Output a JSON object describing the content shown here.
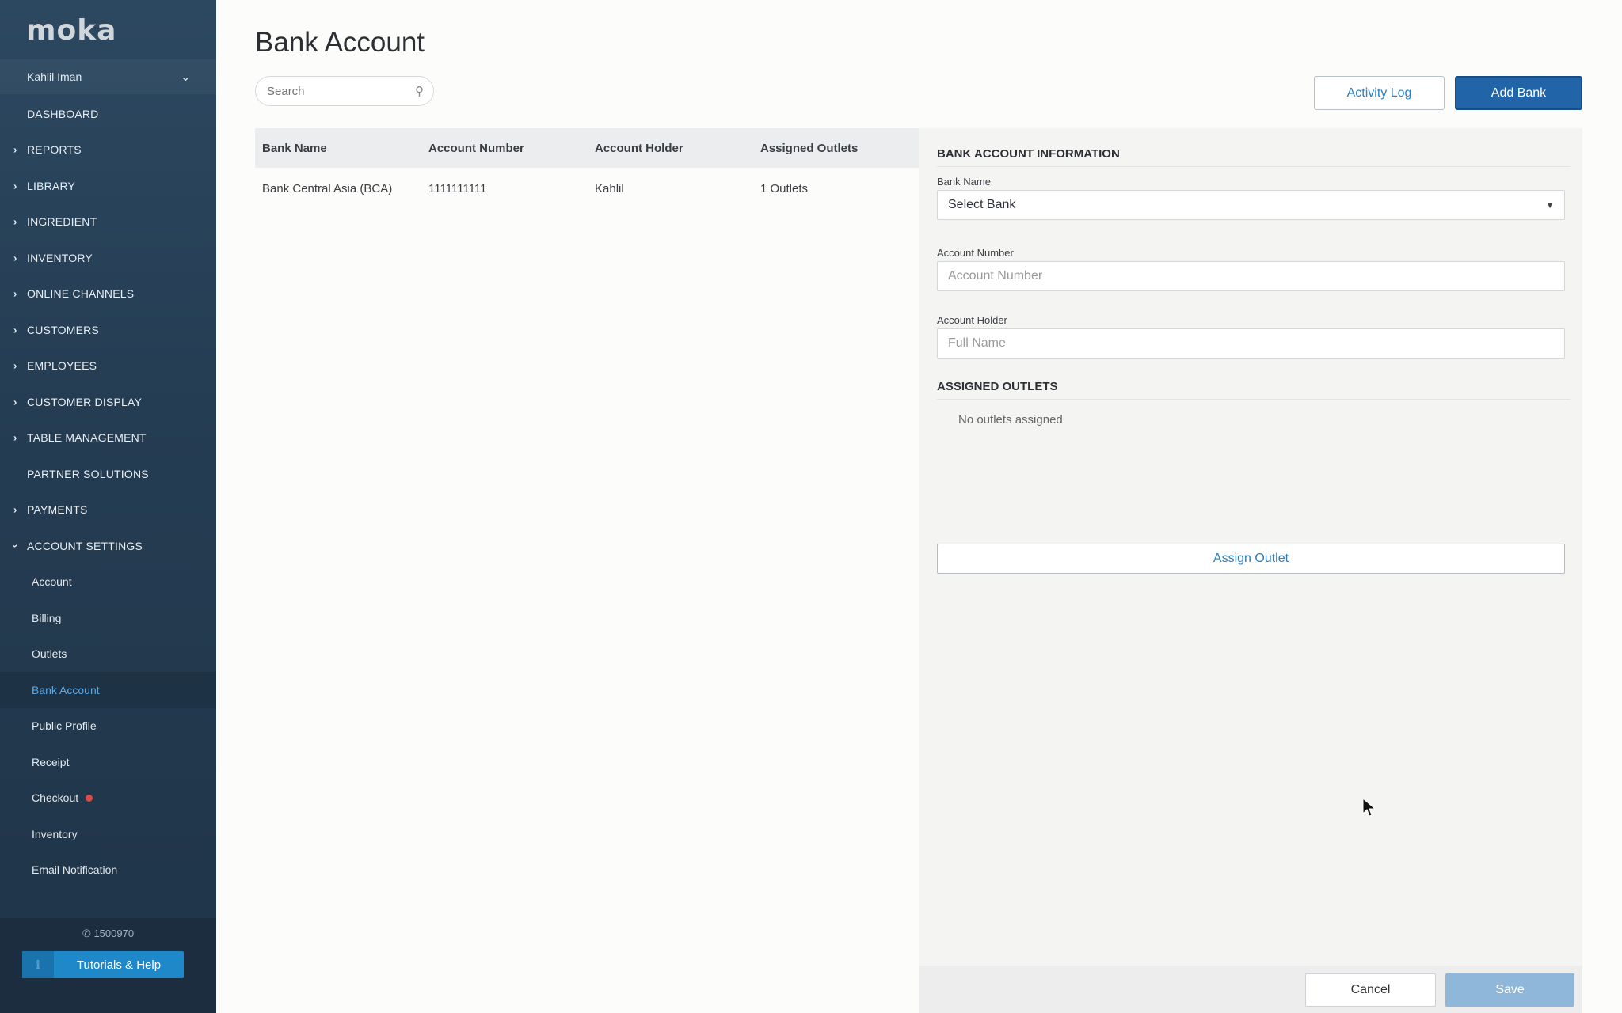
{
  "app": {
    "logo": "moka"
  },
  "sidebar": {
    "user": "Kahlil Iman",
    "nav": [
      {
        "label": "DASHBOARD",
        "arrow": false
      },
      {
        "label": "REPORTS",
        "arrow": true
      },
      {
        "label": "LIBRARY",
        "arrow": true
      },
      {
        "label": "INGREDIENT",
        "arrow": true
      },
      {
        "label": "INVENTORY",
        "arrow": true
      },
      {
        "label": "ONLINE CHANNELS",
        "arrow": true
      },
      {
        "label": "CUSTOMERS",
        "arrow": true
      },
      {
        "label": "EMPLOYEES",
        "arrow": true
      },
      {
        "label": "CUSTOMER DISPLAY",
        "arrow": true
      },
      {
        "label": "TABLE MANAGEMENT",
        "arrow": true
      },
      {
        "label": "PARTNER SOLUTIONS",
        "arrow": false
      },
      {
        "label": "PAYMENTS",
        "arrow": true
      },
      {
        "label": "ACCOUNT SETTINGS",
        "arrow": true,
        "expanded": true
      }
    ],
    "sub_items": [
      {
        "label": "Account"
      },
      {
        "label": "Billing"
      },
      {
        "label": "Outlets"
      },
      {
        "label": "Bank Account",
        "active": true
      },
      {
        "label": "Public Profile"
      },
      {
        "label": "Receipt"
      },
      {
        "label": "Checkout",
        "dot": true
      },
      {
        "label": "Inventory"
      },
      {
        "label": "Email Notification"
      }
    ],
    "phone": "1500970",
    "help_button": "Tutorials & Help"
  },
  "main": {
    "title": "Bank Account",
    "search_placeholder": "Search",
    "activity_log": "Activity Log",
    "add_bank": "Add Bank",
    "table": {
      "headers": [
        "Bank Name",
        "Account Number",
        "Account Holder",
        "Assigned Outlets"
      ],
      "rows": [
        [
          "Bank Central Asia (BCA)",
          "1111111111",
          "Kahlil",
          "1 Outlets"
        ]
      ]
    }
  },
  "panel": {
    "section_title": "BANK ACCOUNT INFORMATION",
    "bank_name_label": "Bank Name",
    "bank_name_value": "Select Bank",
    "account_number_label": "Account Number",
    "account_number_placeholder": "Account Number",
    "account_holder_label": "Account Holder",
    "account_holder_placeholder": "Full Name",
    "outlets_title": "ASSIGNED OUTLETS",
    "no_outlets": "No outlets assigned",
    "assign_outlet": "Assign Outlet",
    "cancel": "Cancel",
    "save": "Save"
  },
  "colors": {
    "sidebar_bg": "#253d53",
    "primary": "#2165a8",
    "link": "#2c7fbf",
    "save_disabled": "#8fb7d9"
  }
}
